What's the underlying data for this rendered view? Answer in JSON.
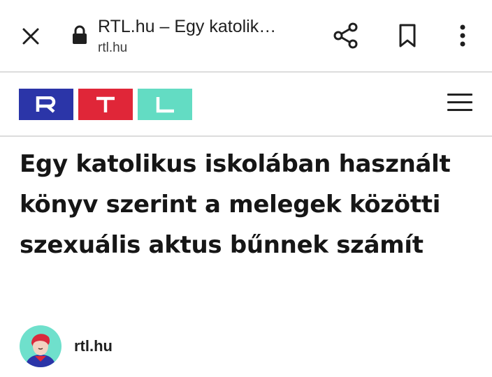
{
  "browser": {
    "page_title": "RTL.hu – Egy katolik…",
    "domain": "rtl.hu"
  },
  "icons": {
    "close": "close-icon",
    "lock": "lock-icon",
    "share": "share-icon",
    "bookmark": "bookmark-icon",
    "menu": "more-vert-icon",
    "hamburger": "hamburger-menu-icon"
  },
  "logo": {
    "letters": [
      "R",
      "T",
      "L"
    ],
    "colors": [
      "#2b35a8",
      "#e02638",
      "#63dcc3"
    ]
  },
  "article": {
    "headline": "Egy katolikus iskolában használt könyv szerint a melegek közötti szexuális aktus bűnnek számít",
    "source_name": "rtl.hu"
  }
}
